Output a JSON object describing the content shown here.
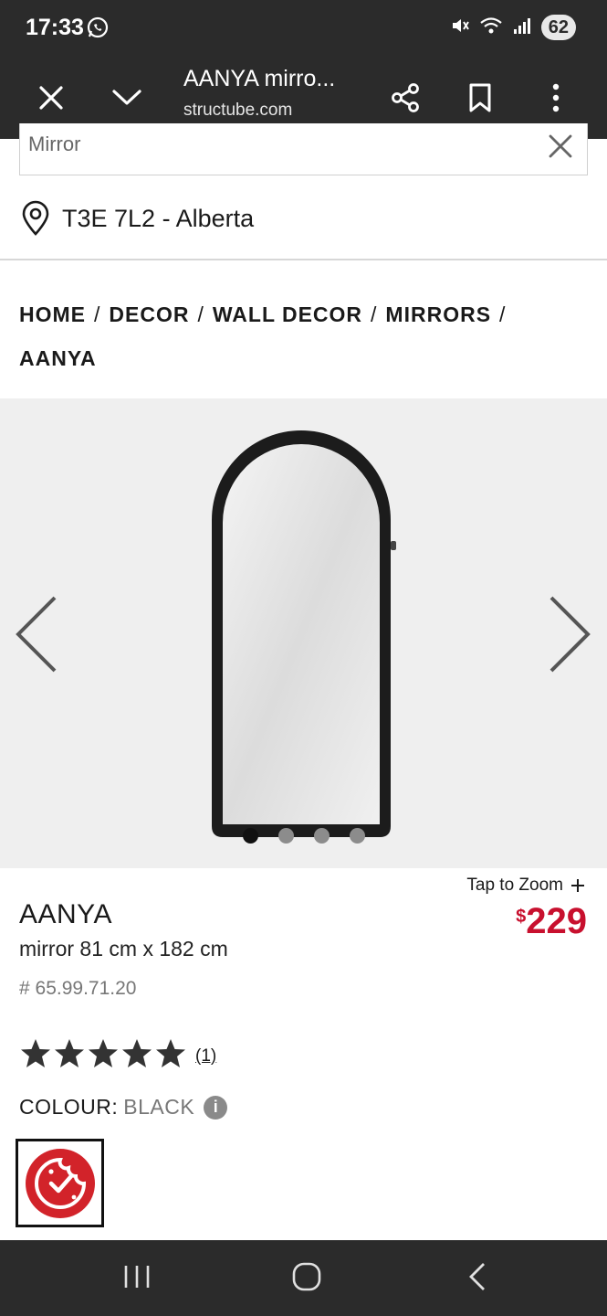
{
  "status_bar": {
    "time": "17:33",
    "battery": "62"
  },
  "browser": {
    "title": "AANYA mirro...",
    "url": "structube.com"
  },
  "search": {
    "value": "Mirror"
  },
  "location": {
    "text": "T3E 7L2 - Alberta"
  },
  "breadcrumb": {
    "items": [
      "HOME",
      "DECOR",
      "WALL DECOR",
      "MIRRORS",
      "AANYA"
    ],
    "separator": "/"
  },
  "carousel": {
    "slide_count": 4,
    "active_index": 0
  },
  "product": {
    "name": "AANYA",
    "description": "mirror 81 cm x 182 cm",
    "sku": "# 65.99.71.20",
    "zoom_label": "Tap to Zoom",
    "price_currency": "$",
    "price_value": "229",
    "rating_stars": 5,
    "review_count": "(1)",
    "colour_label": "COLOUR:",
    "colour_value": "BLACK"
  },
  "colors": {
    "chrome": "#2b2b2b",
    "price": "#c8102e",
    "cookie_badge": "#d2232a"
  }
}
